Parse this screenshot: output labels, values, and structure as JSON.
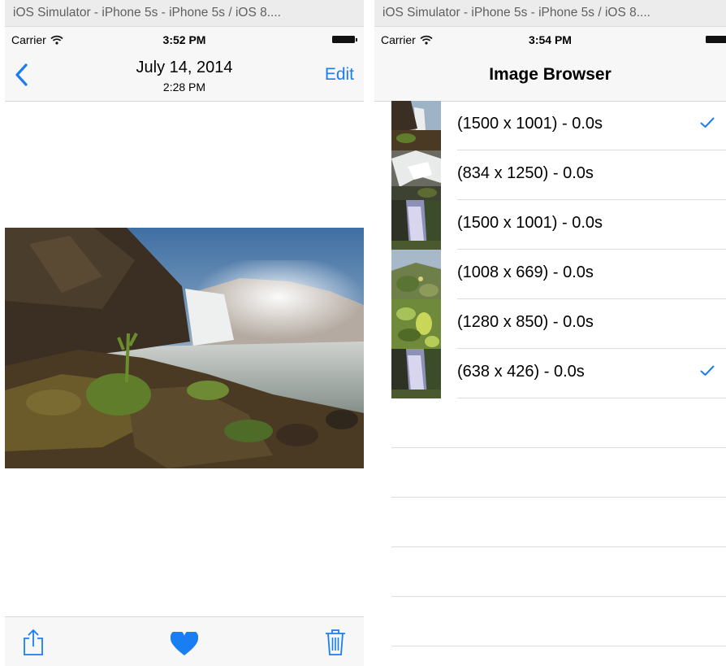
{
  "left": {
    "window_title": "iOS Simulator - iPhone 5s - iPhone 5s / iOS 8....",
    "status": {
      "carrier": "Carrier",
      "time": "3:52 PM"
    },
    "nav": {
      "title": "July 14, 2014",
      "subtitle": "2:28 PM",
      "edit_label": "Edit"
    },
    "toolbar": {
      "icons": [
        "share-icon",
        "heart-icon",
        "trash-icon"
      ]
    }
  },
  "right": {
    "window_title": "iOS Simulator - iPhone 5s - iPhone 5s / iOS 8....",
    "status": {
      "carrier": "Carrier",
      "time": "3:54 PM"
    },
    "nav": {
      "title": "Image Browser"
    },
    "rows": [
      {
        "label": "(1500 x 1001) - 0.0s",
        "checked": true
      },
      {
        "label": "(834 x 1250) - 0.0s",
        "checked": false
      },
      {
        "label": "(1500 x 1001) - 0.0s",
        "checked": false
      },
      {
        "label": "(1008 x 669) - 0.0s",
        "checked": false
      },
      {
        "label": "(1280 x 850) - 0.0s",
        "checked": false
      },
      {
        "label": "(638 x 426) - 0.0s",
        "checked": true
      }
    ]
  },
  "colors": {
    "accent": "#1a7ef3",
    "bar_bg": "#f7f7f7",
    "separator": "#dcdcdc"
  }
}
